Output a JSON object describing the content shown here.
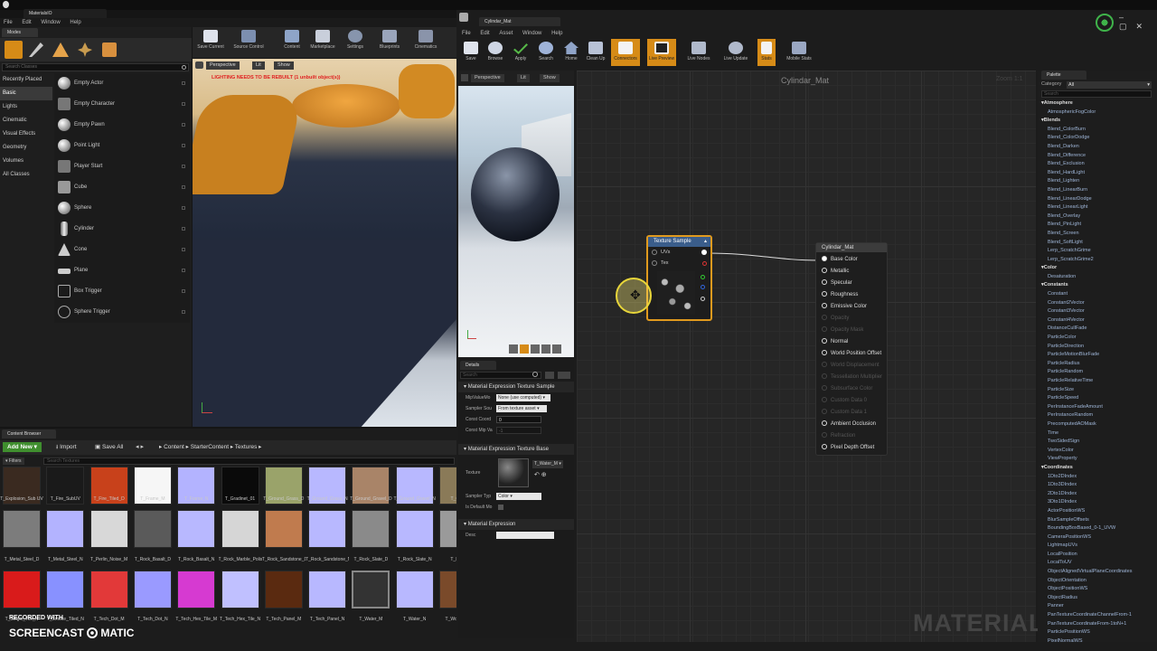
{
  "left_window": {
    "title": "MaterialsIO",
    "menu": [
      "File",
      "Edit",
      "Window",
      "Help"
    ],
    "modes_tab": "Modes",
    "search_placeholder": "Search Classes",
    "categories": [
      "Recently Placed",
      "Basic",
      "Lights",
      "Cinematic",
      "Visual Effects",
      "Geometry",
      "Volumes",
      "All Classes"
    ],
    "place_items": [
      "Empty Actor",
      "Empty Character",
      "Empty Pawn",
      "Point Light",
      "Player Start",
      "Cube",
      "Sphere",
      "Cylinder",
      "Cone",
      "Plane",
      "Box Trigger",
      "Sphere Trigger"
    ],
    "toolbar": [
      "Save Current",
      "Source Control",
      "Content",
      "Marketplace",
      "Settings",
      "Blueprints",
      "Cinematics"
    ],
    "viewport": {
      "perspective": "Perspective",
      "lit": "Lit",
      "show": "Show",
      "warning": "LIGHTING NEEDS TO BE REBUILT (1 unbuilt object(s))"
    }
  },
  "content_browser": {
    "tab": "Content Browser",
    "add_new": "Add New",
    "import": "Import",
    "save_all": "Save All",
    "path": [
      "Content",
      "StarterContent",
      "Textures"
    ],
    "filters": "Filters",
    "search_placeholder": "Search Textures",
    "row1": [
      "T_Explosion_Sub UV",
      "T_Fire_SubUV",
      "T_Fire_Tiled_D",
      "T_Frame_M",
      "T_Frame_N",
      "T_Gradinet_01",
      "T_Ground_Grass_D",
      "T_Ground_Grass_N",
      "T_Ground_Gravel_D",
      "T_Ground_Gravel_N",
      "T_Grou"
    ],
    "row2": [
      "T_Metal_Steel_D",
      "T_Metal_Steel_N",
      "T_Perlin_Noise_M",
      "T_Rock_Basalt_D",
      "T_Rock_Basalt_N",
      "T_Rock_Marble_Polished_D",
      "T_Rock_Sandstone_D",
      "T_Rock_Sandstone_N",
      "T_Rock_Slate_D",
      "T_Rock_Slate_N",
      "T_Rock"
    ],
    "row3": [
      "T_Single_Tile_N",
      "T_Smoke_Tiled_N",
      "T_Tech_Dot_M",
      "T_Tech_Dot_N",
      "T_Tech_Hex_Tile_M",
      "T_Tech_Hex_Tile_N",
      "T_Tech_Panel_M",
      "T_Tech_Panel_N",
      "T_Water_M",
      "T_Water_N",
      "T_Wood_Wa"
    ]
  },
  "mat_window": {
    "title": "Cylindar_Mat",
    "menu": [
      "File",
      "Edit",
      "Asset",
      "Window",
      "Help"
    ],
    "toolbar": [
      "Save",
      "Browse",
      "Apply",
      "Search",
      "Home",
      "Clean Up",
      "Connectors",
      "Live Preview",
      "Live Nodes",
      "Live Update",
      "Stats",
      "Mobile Stats"
    ],
    "preview": {
      "perspective": "Perspective",
      "lit": "Lit",
      "show": "Show"
    },
    "graph_title": "Cylindar_Mat",
    "zoom": "Zoom 1:1",
    "watermark": "MATERIAL"
  },
  "texture_node": {
    "title": "Texture Sample",
    "uvs": "UVs",
    "tex": "Tex"
  },
  "result_node": {
    "title": "Cylindar_Mat",
    "pins": [
      {
        "label": "Base Color",
        "on": true,
        "dim": false
      },
      {
        "label": "Metallic",
        "on": false,
        "dim": false
      },
      {
        "label": "Specular",
        "on": false,
        "dim": false
      },
      {
        "label": "Roughness",
        "on": false,
        "dim": false
      },
      {
        "label": "Emissive Color",
        "on": false,
        "dim": false
      },
      {
        "label": "Opacity",
        "on": false,
        "dim": true
      },
      {
        "label": "Opacity Mask",
        "on": false,
        "dim": true
      },
      {
        "label": "Normal",
        "on": false,
        "dim": false
      },
      {
        "label": "World Position Offset",
        "on": false,
        "dim": false
      },
      {
        "label": "World Displacement",
        "on": false,
        "dim": true
      },
      {
        "label": "Tessellation Multiplier",
        "on": false,
        "dim": true
      },
      {
        "label": "Subsurface Color",
        "on": false,
        "dim": true
      },
      {
        "label": "Custom Data 0",
        "on": false,
        "dim": true
      },
      {
        "label": "Custom Data 1",
        "on": false,
        "dim": true
      },
      {
        "label": "Ambient Occlusion",
        "on": false,
        "dim": false
      },
      {
        "label": "Refraction",
        "on": false,
        "dim": true
      },
      {
        "label": "Pixel Depth Offset",
        "on": false,
        "dim": false
      }
    ]
  },
  "details": {
    "tab": "Details",
    "search_placeholder": "Search",
    "section1": "Material Expression Texture Sample",
    "mip_value_mode_label": "MipValueMo",
    "mip_value_mode": "None (use computed)",
    "sampler_source_label": "Sampler Sou",
    "sampler_source": "From texture asset",
    "const_coord_label": "Const Coord",
    "const_coord": "0",
    "const_mip_label": "Const Mip Va",
    "const_mip": "-1",
    "section2": "Material Expression Texture Base",
    "texture_label": "Texture",
    "texture_value": "T_Water_M",
    "sampler_type_label": "Sampler Typ",
    "sampler_type": "Color",
    "is_default_label": "Is Default Mo",
    "section3": "Material Expression",
    "desc_label": "Desc"
  },
  "palette": {
    "tab": "Palette",
    "category_label": "Category",
    "category_value": "All",
    "search_placeholder": "Search",
    "entries": [
      {
        "t": "c",
        "s": "Atmosphere"
      },
      {
        "t": "i",
        "s": "AtmosphericFogColor"
      },
      {
        "t": "c",
        "s": "Blends"
      },
      {
        "t": "i",
        "s": "Blend_ColorBurn"
      },
      {
        "t": "i",
        "s": "Blend_ColorDodge"
      },
      {
        "t": "i",
        "s": "Blend_Darken"
      },
      {
        "t": "i",
        "s": "Blend_Difference"
      },
      {
        "t": "i",
        "s": "Blend_Exclusion"
      },
      {
        "t": "i",
        "s": "Blend_HardLight"
      },
      {
        "t": "i",
        "s": "Blend_Lighten"
      },
      {
        "t": "i",
        "s": "Blend_LinearBurn"
      },
      {
        "t": "i",
        "s": "Blend_LinearDodge"
      },
      {
        "t": "i",
        "s": "Blend_LinearLight"
      },
      {
        "t": "i",
        "s": "Blend_Overlay"
      },
      {
        "t": "i",
        "s": "Blend_PinLight"
      },
      {
        "t": "i",
        "s": "Blend_Screen"
      },
      {
        "t": "i",
        "s": "Blend_SoftLight"
      },
      {
        "t": "i",
        "s": "Lerp_ScratchGrime"
      },
      {
        "t": "i",
        "s": "Lerp_ScratchGrime2"
      },
      {
        "t": "c",
        "s": "Color"
      },
      {
        "t": "i",
        "s": "Desaturation"
      },
      {
        "t": "c",
        "s": "Constants"
      },
      {
        "t": "i",
        "s": "Constant"
      },
      {
        "t": "i",
        "s": "Constant2Vector"
      },
      {
        "t": "i",
        "s": "Constant3Vector"
      },
      {
        "t": "i",
        "s": "Constant4Vector"
      },
      {
        "t": "i",
        "s": "DistanceCullFade"
      },
      {
        "t": "i",
        "s": "ParticleColor"
      },
      {
        "t": "i",
        "s": "ParticleDirection"
      },
      {
        "t": "i",
        "s": "ParticleMotionBlurFade"
      },
      {
        "t": "i",
        "s": "ParticleRadius"
      },
      {
        "t": "i",
        "s": "ParticleRandom"
      },
      {
        "t": "i",
        "s": "ParticleRelativeTime"
      },
      {
        "t": "i",
        "s": "ParticleSize"
      },
      {
        "t": "i",
        "s": "ParticleSpeed"
      },
      {
        "t": "i",
        "s": "PerInstanceFadeAmount"
      },
      {
        "t": "i",
        "s": "PerInstanceRandom"
      },
      {
        "t": "i",
        "s": "PrecomputedAOMask"
      },
      {
        "t": "i",
        "s": "Time"
      },
      {
        "t": "i",
        "s": "TwoSidedSign"
      },
      {
        "t": "i",
        "s": "VertexColor"
      },
      {
        "t": "i",
        "s": "ViewProperty"
      },
      {
        "t": "c",
        "s": "Coordinates"
      },
      {
        "t": "i",
        "s": "1Dto2DIndex"
      },
      {
        "t": "i",
        "s": "1Dto3DIndex"
      },
      {
        "t": "i",
        "s": "2Dto1DIndex"
      },
      {
        "t": "i",
        "s": "3Dto1DIndex"
      },
      {
        "t": "i",
        "s": "ActorPositionWS"
      },
      {
        "t": "i",
        "s": "BlurSampleOffsets"
      },
      {
        "t": "i",
        "s": "BoundingBoxBased_0-1_UVW"
      },
      {
        "t": "i",
        "s": "CameraPositionWS"
      },
      {
        "t": "i",
        "s": "LightmapUVs"
      },
      {
        "t": "i",
        "s": "LocalPosition"
      },
      {
        "t": "i",
        "s": "LocalToUV"
      },
      {
        "t": "i",
        "s": "ObjectAlignedVirtualPlaneCoordinates"
      },
      {
        "t": "i",
        "s": "ObjectOrientation"
      },
      {
        "t": "i",
        "s": "ObjectPositionWS"
      },
      {
        "t": "i",
        "s": "ObjectRadius"
      },
      {
        "t": "i",
        "s": "Panner"
      },
      {
        "t": "i",
        "s": "PanTextureCoordinateChannelFrom-1"
      },
      {
        "t": "i",
        "s": "PanTextureCoordinateFrom-1toN+1"
      },
      {
        "t": "i",
        "s": "ParticlePositionWS"
      },
      {
        "t": "i",
        "s": "PixelNormalWS"
      }
    ]
  },
  "recording": {
    "line1": "RECORDED WITH",
    "line2": "SCREENCAST",
    "line3": "MATIC"
  }
}
